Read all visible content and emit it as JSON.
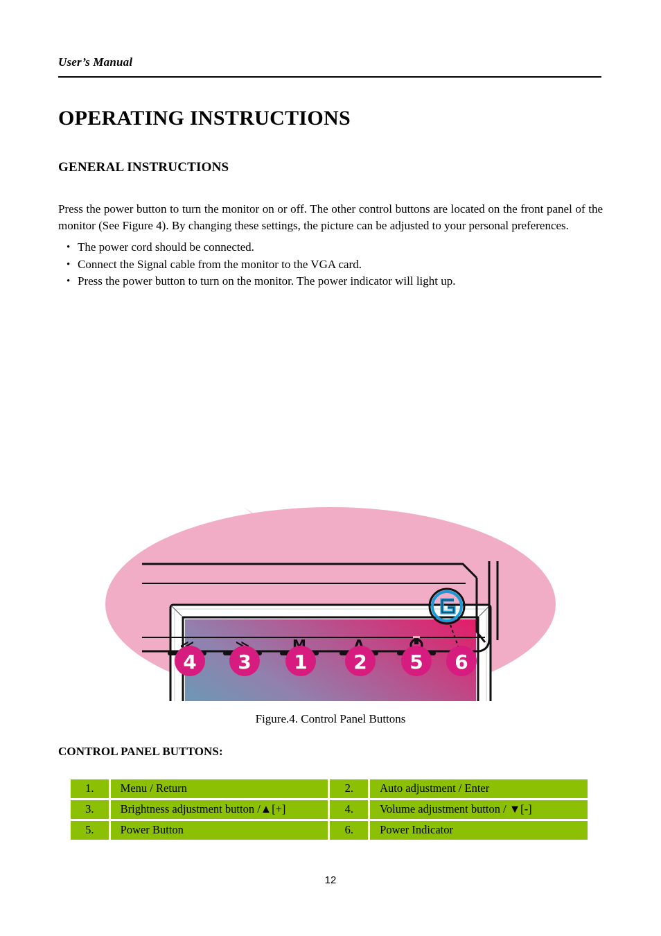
{
  "header": {
    "running_title": "User’s Manual"
  },
  "headings": {
    "h1": "OPERATING INSTRUCTIONS",
    "h2": "GENERAL INSTRUCTIONS",
    "table_heading": "CONTROL PANEL BUTTONS:"
  },
  "body": {
    "paragraph": "Press the power button to turn the monitor on or off. The other control buttons are located on the front panel of the monitor (See Figure 4). By changing these settings, the picture can be adjusted to your personal preferences.",
    "bullet_marker": "•",
    "bullets": [
      "The power cord should be connected.",
      "Connect the Signal cable from the monitor to the VGA card.",
      "Press the power button to turn on the monitor. The power indicator will light up."
    ]
  },
  "figure": {
    "caption": "Figure.4. Control Panel Buttons",
    "screen_gradient": {
      "from": "#3BB6BE",
      "to": "#E31C68"
    },
    "callout_fill": "#F2ADC6",
    "marker_fill": "#D61C7E",
    "marker_text_color": "#FFFFFF",
    "logo_color": "#1B9AD6",
    "brand_logo": "G",
    "panel_glyphs": [
      {
        "glyph": "≪",
        "name": "left-arrow"
      },
      {
        "glyph": "≫",
        "name": "right-arrow"
      },
      {
        "glyph": "M",
        "name": "menu"
      },
      {
        "glyph": "A",
        "name": "auto"
      },
      {
        "glyph": "⏻",
        "name": "power"
      }
    ],
    "markers": [
      "4",
      "3",
      "1",
      "2",
      "5",
      "6"
    ]
  },
  "control_panel_table": {
    "cell_color": "#8CC004",
    "rows": [
      [
        {
          "num": "1.",
          "label": "Menu / Return"
        },
        {
          "num": "2.",
          "label": "Auto adjustment / Enter"
        }
      ],
      [
        {
          "num": "3.",
          "label": "Brightness adjustment button /▲[+]"
        },
        {
          "num": "4.",
          "label": "Volume adjustment button /  ▼[-]"
        }
      ],
      [
        {
          "num": "5.",
          "label": "Power Button"
        },
        {
          "num": "6.",
          "label": "Power Indicator"
        }
      ]
    ]
  },
  "footer": {
    "page_number": "12"
  }
}
